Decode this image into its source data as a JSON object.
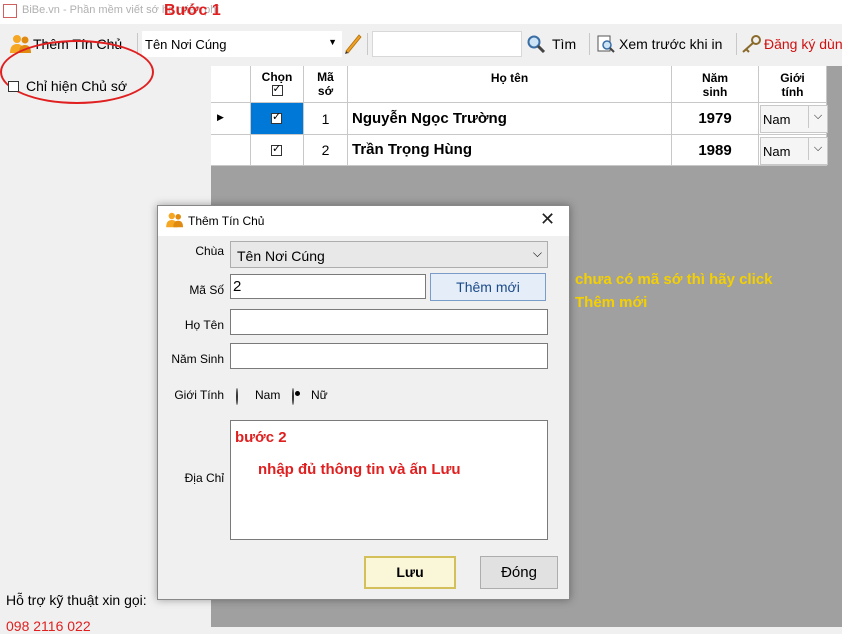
{
  "window": {
    "title": "BiBe.vn - Phần mềm viết sớ hộ miễn phí"
  },
  "annotations": {
    "step1": "Bước 1",
    "step2": "bước 2",
    "step2_hint": "nhập đủ thông tin và ấn Lưu",
    "hint_line1": "chưa có mã sớ thì hãy click",
    "hint_line2": "Thêm mới"
  },
  "toolbar": {
    "add_owner_label": "Thêm Tín Chủ",
    "place_combo_value": "Tên Nơi Cúng",
    "search_value": "",
    "search_label": "Tìm",
    "preview_label": "Xem trước khi in",
    "register_label": "Đăng ký dùn"
  },
  "sidebar": {
    "filter_label": "Chỉ hiện Chủ sớ",
    "filter_checked": false,
    "support_label": "Hỗ trợ kỹ thuật xin gọi:",
    "support_phone": "098 2116 022"
  },
  "grid": {
    "columns": [
      "Chọn",
      "Mã sớ",
      "Họ tên",
      "Năm sinh",
      "Giới tính"
    ],
    "rows": [
      {
        "selected": true,
        "ma_so": "1",
        "ho_ten": "Nguyễn Ngọc Trường",
        "nam_sinh": "1979",
        "gioi_tinh": "Nam"
      },
      {
        "selected": true,
        "ma_so": "2",
        "ho_ten": "Trần Trọng Hùng",
        "nam_sinh": "1989",
        "gioi_tinh": "Nam"
      }
    ]
  },
  "dialog": {
    "title": "Thêm Tín Chủ",
    "chua_label": "Chùa",
    "chua_value": "Tên Nơi Cúng",
    "ma_so_label": "Mã Số",
    "ma_so_value": "2",
    "add_new_label": "Thêm mới",
    "ho_ten_label": "Họ Tên",
    "ho_ten_value": "",
    "nam_sinh_label": "Năm Sinh",
    "nam_sinh_value": "",
    "gioi_tinh_label": "Giới Tính",
    "gender_options": [
      "Nam",
      "Nữ"
    ],
    "gender_selected": "Nữ",
    "dia_chi_label": "Địa Chỉ",
    "save_label": "Lưu",
    "close_label": "Đóng"
  },
  "colors": {
    "annotation_red": "#e02020",
    "annotation_yellow": "#f5d000",
    "selection_blue": "#0078d7",
    "register_red": "#d01010"
  }
}
